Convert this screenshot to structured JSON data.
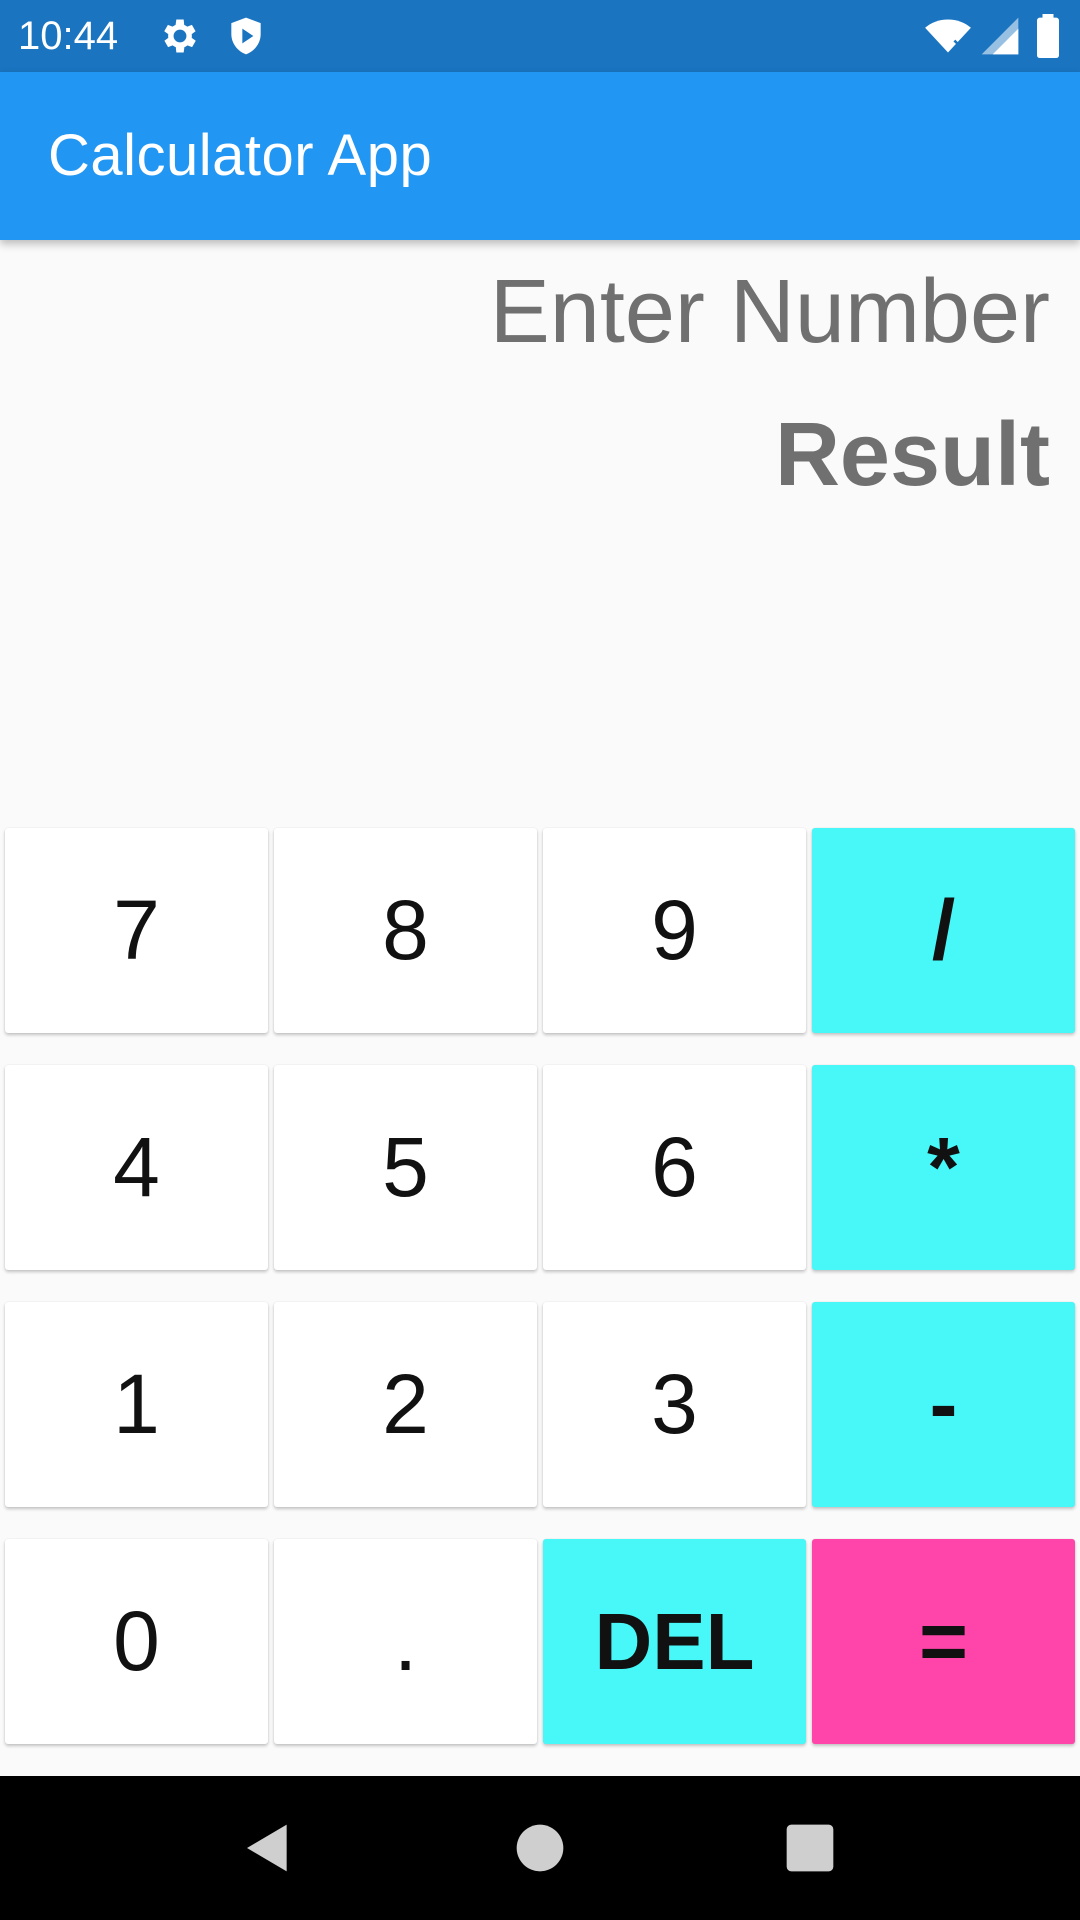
{
  "status_bar": {
    "time": "10:44",
    "icons": [
      "gear-icon",
      "shield-icon",
      "wifi-icon",
      "signal-icon",
      "battery-icon"
    ]
  },
  "app_bar": {
    "title": "Calculator App",
    "color": "#2196f3"
  },
  "display": {
    "input_text": "Enter Number",
    "result_text": "Result"
  },
  "keypad": {
    "rows": [
      [
        {
          "label": "7"
        },
        {
          "label": "8"
        },
        {
          "label": "9"
        },
        {
          "label": "/"
        }
      ],
      [
        {
          "label": "4"
        },
        {
          "label": "5"
        },
        {
          "label": "6"
        },
        {
          "label": "*"
        }
      ],
      [
        {
          "label": "1"
        },
        {
          "label": "2"
        },
        {
          "label": "3"
        },
        {
          "label": "-"
        }
      ],
      [
        {
          "label": "0"
        },
        {
          "label": "."
        },
        {
          "label": "DEL"
        },
        {
          "label": "="
        }
      ]
    ],
    "colors": {
      "number": "#ffffff",
      "operator": "#48f7f8",
      "equals": "#ff45aa"
    }
  },
  "nav_bar": {
    "buttons": [
      "back-icon",
      "home-icon",
      "recents-icon"
    ]
  }
}
